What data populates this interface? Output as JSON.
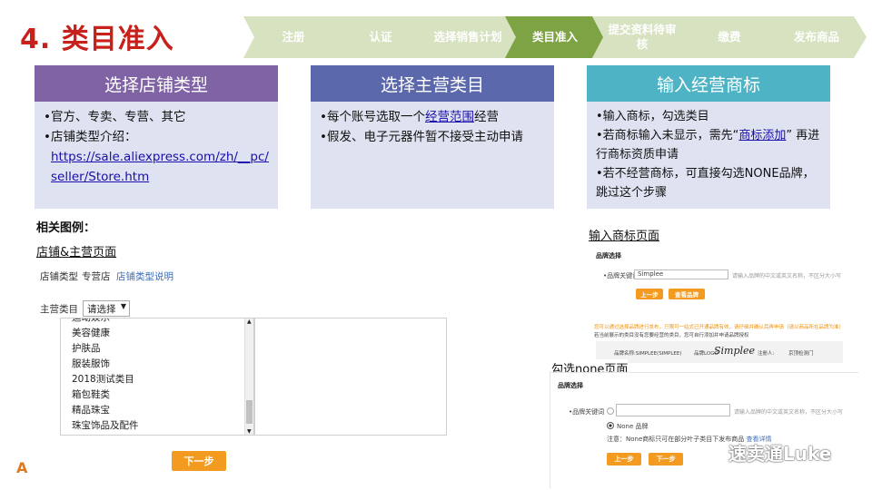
{
  "title": "4. 类目准入",
  "steps": [
    {
      "label": "注册",
      "active": false
    },
    {
      "label": "认证",
      "active": false
    },
    {
      "label": "选择销售计划",
      "active": false
    },
    {
      "label": "类目准入",
      "active": true
    },
    {
      "label": "提交资料待审核",
      "active": false
    },
    {
      "label": "缴费",
      "active": false
    },
    {
      "label": "发布商品",
      "active": false
    }
  ],
  "colors": {
    "title": "#c8201b",
    "step_inactive": "#d6e2c0",
    "step_active": "#7ea344",
    "card1_head": "#8063a4",
    "card2_head": "#5b69ac",
    "card3_head": "#4eb3c5",
    "card_body": "#dfe3f1",
    "button_orange": "#f39a20"
  },
  "cards": [
    {
      "title": "选择店铺类型",
      "bullets": [
        "•官方、专卖、专营、其它",
        "•店铺类型介绍："
      ],
      "link": "https://sale.aliexpress.com/zh/__pc/seller/Store.htm"
    },
    {
      "title": "选择主营类目",
      "b1_pre": "•每个账号选取一个",
      "b1_link": "经营范围",
      "b1_post": "经营",
      "b2": "•假发、电子元器件暂不接受主动申请"
    },
    {
      "title": "输入经营商标",
      "b1": "•输入商标，勾选类目",
      "b2_pre": "•若商标输入未显示，需先“",
      "b2_link": "商标添加",
      "b2_post": "” 再进行商标资质申请",
      "b3": "•若不经营商标，可直接勾选NONE品牌，跳过这个步骤"
    }
  ],
  "left_section": {
    "heading": "相关图例：",
    "subheading": "店铺&主营页面",
    "store_type_label": "店铺类型",
    "store_type_value": "专营店",
    "store_type_link": "店铺类型说明",
    "main_cat_label": "主营类目",
    "select_placeholder": "请选择",
    "categories": [
      "运动娱乐",
      "美容健康",
      "护肤品",
      "服装服饰",
      "2018测试类目",
      "箱包鞋类",
      "精品珠宝",
      "珠宝饰品及配件"
    ],
    "next_button": "下一步"
  },
  "right_top": {
    "caption": "输入商标页面",
    "section_title": "品牌选择",
    "brand_keyword_label": "•品牌关键词",
    "brand_input_value": "Simplee",
    "input_hint": "请输入品牌的中文或英文名称，不区分大小写",
    "prev_button": "上一步",
    "query_button": "查看品牌",
    "warning_text": "您可以通过选择品牌进行发布，只限可一站式已开通品牌有效，请仔细并确认后再申请（请以商品所在品牌为准）",
    "note_text": "若当前展示的类目没有您要经营的类目，您可自行添加并申请品牌授权",
    "brand_name_label": "品牌名称:SIMPLEE(SIMPLEE)",
    "brand_logo_label": "品牌LOGO",
    "brand_logo_text": "Simplee",
    "registrant_label": "注册人:",
    "registrant_value": "京顶检测门"
  },
  "right_bottom": {
    "caption": "勾选none页面",
    "section_title": "品牌选择",
    "brand_keyword_label": "•品牌关键词",
    "input_hint": "请输入品牌的中文或英文名称，不区分大小写",
    "none_option": "None 品牌",
    "note_text": "注意：None商标只可在部分叶子类目下发布商品",
    "note_link": "查看详情",
    "prev_button": "上一步",
    "next_button": "下一步"
  },
  "watermark": "速卖通Luke",
  "corner_letter": "A"
}
